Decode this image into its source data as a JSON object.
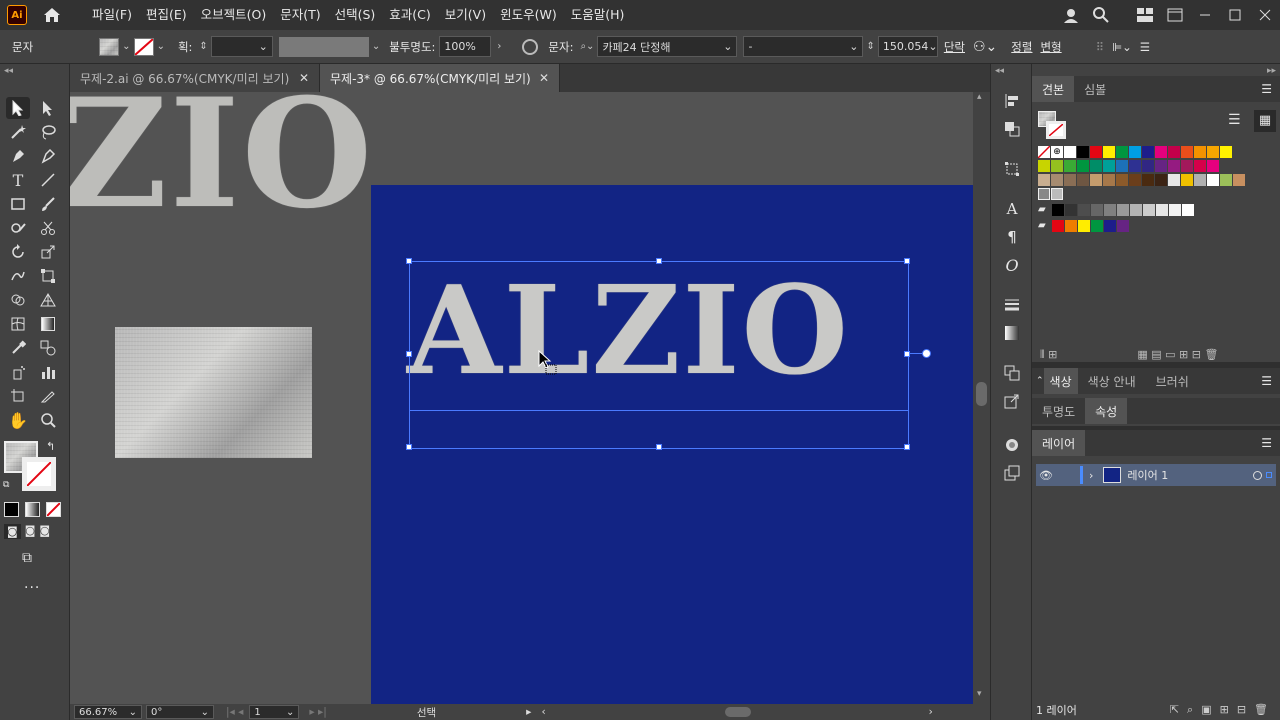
{
  "app": {
    "logo": "Ai"
  },
  "menu": [
    "파일(F)",
    "편집(E)",
    "오브젝트(O)",
    "문자(T)",
    "선택(S)",
    "효과(C)",
    "보기(V)",
    "윈도우(W)",
    "도움말(H)"
  ],
  "control_bar": {
    "object_type": "문자",
    "stroke_label": "획:",
    "opacity_label": "불투명도:",
    "opacity_value": "100%",
    "char_label": "문자:",
    "font_family": "카페24 단정해",
    "font_style": "-",
    "font_size": "150.054",
    "paragraph_label": "단락",
    "align_label": "정렬",
    "transform_label": "변형"
  },
  "tabs": [
    {
      "label": "무제-2.ai @ 66.67%(CMYK/미리 보기)",
      "active": false
    },
    {
      "label": "무제-3* @ 66.67%(CMYK/미리 보기)",
      "active": true
    }
  ],
  "canvas": {
    "artboard_text": "ALZIO",
    "pasteboard_text": "ZIO",
    "artboard_color": "#122484"
  },
  "status": {
    "zoom": "66.67%",
    "rotation": "0°",
    "page": "1",
    "mode": "선택"
  },
  "swatches_panel": {
    "tabs": [
      "견본",
      "심볼"
    ],
    "row1": [
      "#ffffff",
      "#000000",
      "#e30613",
      "#ffed00",
      "#009640",
      "#009fe3",
      "#1d1d8b",
      "#e5007d",
      "#c4004a",
      "#e94e1b",
      "#f39200",
      "#f7a600",
      "#fff200"
    ],
    "row2": [
      "#c8d400",
      "#95c11f",
      "#3aaa35",
      "#00963f",
      "#008d67",
      "#00a099",
      "#1d71b8",
      "#2e3192",
      "#312783",
      "#662483",
      "#951b81",
      "#a3195b",
      "#d6004a",
      "#e6007e"
    ],
    "row3": [
      "#c9ae90",
      "#a68b70",
      "#8a6e55",
      "#6e5642",
      "#c59c6d",
      "#a6784a",
      "#8c5a2a",
      "#6b3e1b",
      "#4a2a10",
      "#3b2314",
      "#e6e6e6",
      "#f0c000",
      "#b0b0b0",
      "#ffffff",
      "#9cbf5a",
      "#c89060"
    ],
    "row4": [
      "#000000",
      "#333333",
      "#4d4d4d",
      "#666666",
      "#808080",
      "#999999",
      "#b3b3b3",
      "#cccccc",
      "#e6e6e6",
      "#f2f2f2",
      "#ffffff"
    ],
    "row5": [
      "#e30613",
      "#ef7d00",
      "#ffed00",
      "#009640",
      "#1d1d8b",
      "#662483"
    ]
  },
  "color_panel": {
    "tabs": [
      "색상",
      "색상 안내",
      "브러쉬"
    ]
  },
  "props_panel": {
    "tabs": [
      "투명도",
      "속성"
    ]
  },
  "layers_panel": {
    "title": "레이어",
    "layer_name": "레이어 1",
    "footer": "1 레이어",
    "layer_color": "#4a8cff"
  }
}
